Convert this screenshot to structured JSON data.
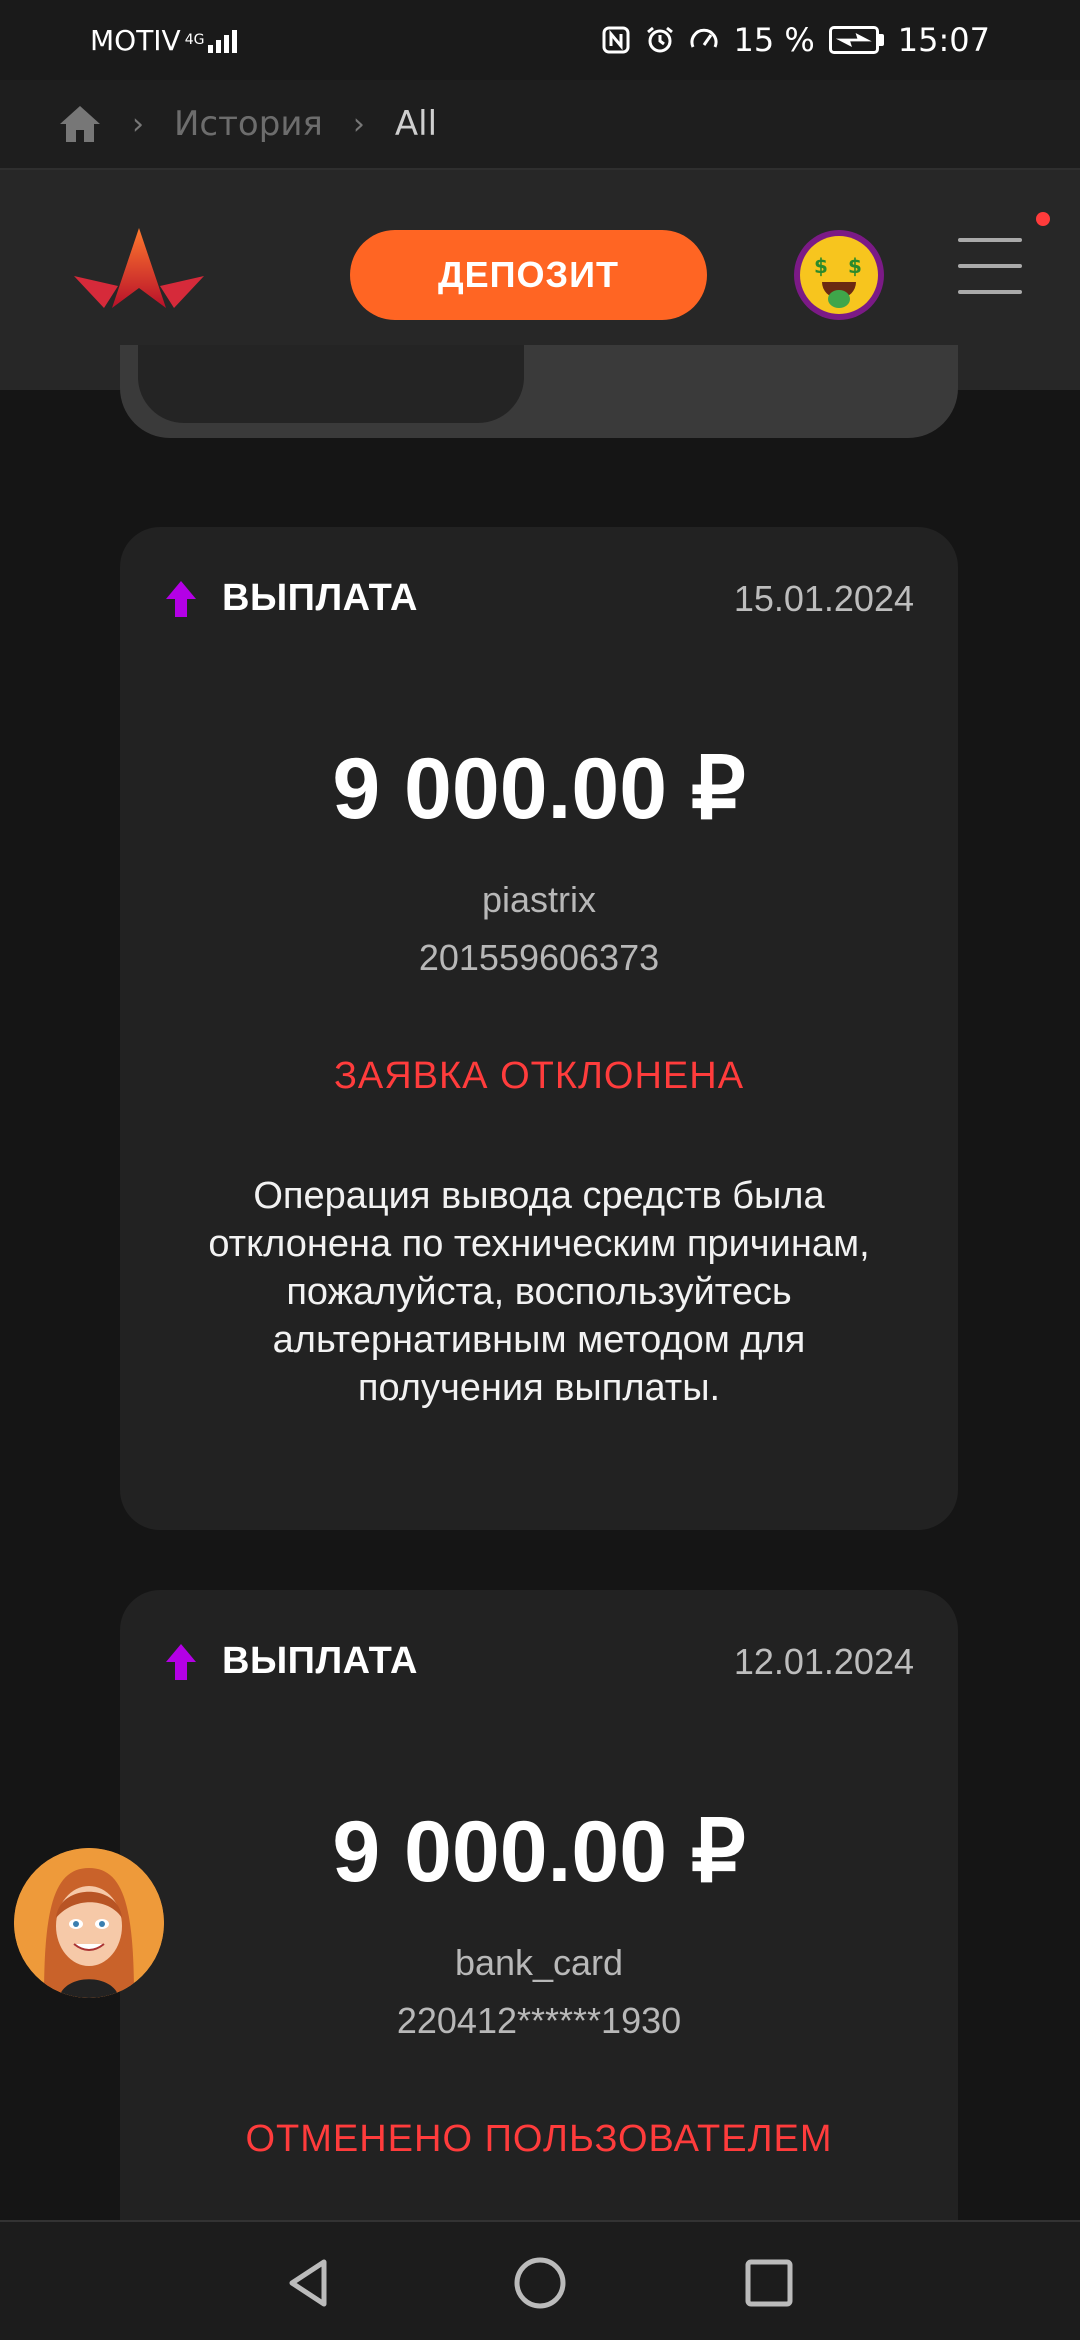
{
  "status_bar": {
    "carrier": "MOTIV",
    "network": "4G",
    "battery": "15 %",
    "time": "15:07"
  },
  "breadcrumb": {
    "items": [
      "История",
      "All"
    ]
  },
  "header": {
    "deposit_label": "ДЕПОЗИТ"
  },
  "transactions": [
    {
      "type": "ВЫПЛАТА",
      "date": "15.01.2024",
      "amount": "9 000.00 ₽",
      "method": "piastrix",
      "account": "201559606373",
      "status": "ЗАЯВКА ОТКЛОНЕНА",
      "message": "Операция вывода средств была отклонена по техническим причинам, пожалуйста, воспользуйтесь альтернативным методом для получения выплаты."
    },
    {
      "type": "ВЫПЛАТА",
      "date": "12.01.2024",
      "amount": "9 000.00 ₽",
      "method": "bank_card",
      "account": "220412******1930",
      "status": "ОТМЕНЕНО ПОЛЬЗОВАТЕЛЕМ"
    }
  ],
  "colors": {
    "accent": "#ff6523",
    "status_red": "#ff3c3c",
    "arrow_purple": "#b400e6",
    "card_bg": "#222222",
    "page_bg": "#151515"
  },
  "icons": {
    "breadcrumb_home": "home-icon",
    "type_arrow": "arrow-up-icon",
    "menu": "hamburger-menu-icon",
    "nav_back": "back-triangle-icon",
    "nav_home": "home-circle-icon",
    "nav_recents": "recents-square-icon"
  }
}
